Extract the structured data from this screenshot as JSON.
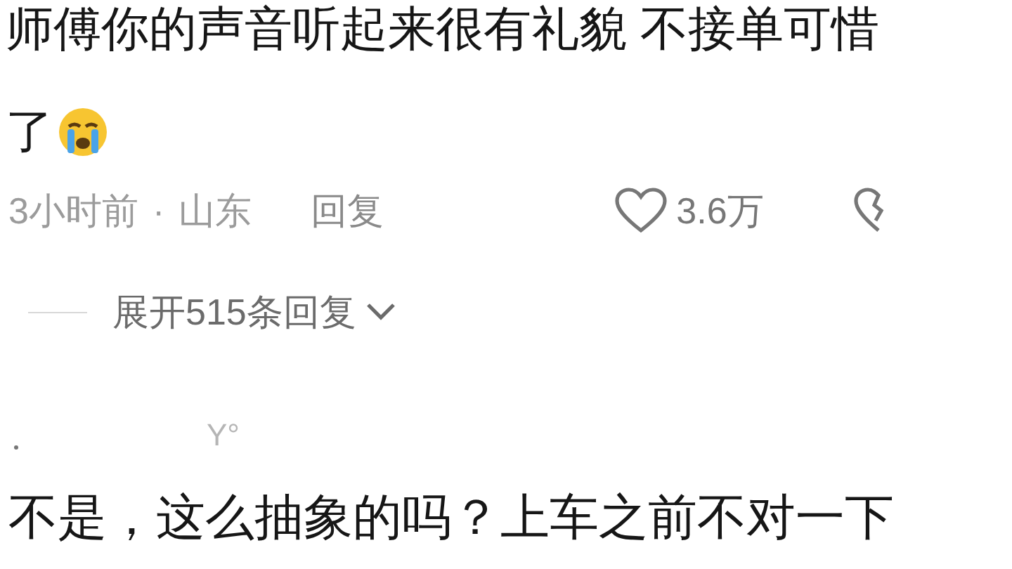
{
  "comment": {
    "lines": [
      "师傅你的声音听起来很有礼貌 不接单可惜",
      "了"
    ],
    "time": "3小时前",
    "separator": "·",
    "location": "山东",
    "reply": "回复",
    "likes": "3.6万",
    "expand_replies": "展开515条回复"
  },
  "next_comment": {
    "username": "Y°",
    "text": "不是，这么抽象的吗？上车之前不对一下"
  }
}
